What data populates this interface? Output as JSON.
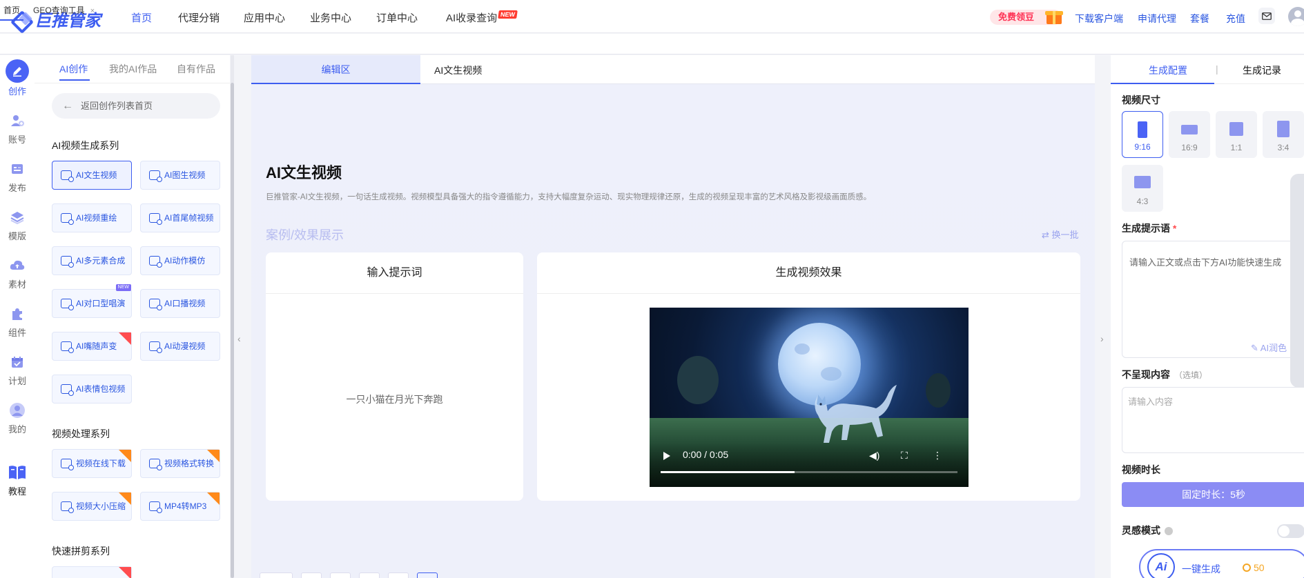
{
  "brand": {
    "name": "巨推管家",
    "accent": "#3d5df0"
  },
  "topnav": {
    "items": [
      {
        "label": "首页",
        "active": true
      },
      {
        "label": "代理分销"
      },
      {
        "label": "应用中心"
      },
      {
        "label": "业务中心"
      },
      {
        "label": "订单中心"
      },
      {
        "label": "AI收录查询",
        "badge": "NEW"
      }
    ],
    "free_label": "免费领豆",
    "right_links": [
      "下载客户端",
      "申请代理",
      "套餐",
      "充值"
    ]
  },
  "tabs": [
    {
      "label": "首页"
    },
    {
      "label": "GEO查询工具",
      "close": "×"
    }
  ],
  "iconbar": [
    {
      "label": "创作",
      "icon": "pen-icon"
    },
    {
      "label": "账号",
      "icon": "user-add-icon"
    },
    {
      "label": "发布",
      "icon": "publish-icon"
    },
    {
      "label": "模版",
      "icon": "layers-icon"
    },
    {
      "label": "素材",
      "icon": "cloud-upload-icon"
    },
    {
      "label": "组件",
      "icon": "puzzle-icon"
    },
    {
      "label": "计划",
      "icon": "calendar-icon"
    },
    {
      "label": "我的",
      "icon": "user-icon"
    },
    {
      "label": "教程",
      "icon": "book-icon"
    }
  ],
  "panel": {
    "tabs": [
      "AI创作",
      "我的AI作品",
      "自有作品"
    ],
    "back_label": "返回创作列表首页",
    "sections": [
      {
        "title": "AI视频生成系列",
        "tools": [
          {
            "label": "AI文生视频",
            "selected": true
          },
          {
            "label": "AI图生视频"
          },
          {
            "label": "AI视频重绘"
          },
          {
            "label": "AI首尾帧视频"
          },
          {
            "label": "AI多元素合成"
          },
          {
            "label": "AI动作模仿"
          },
          {
            "label": "AI对口型唱演",
            "tag": "NEW"
          },
          {
            "label": "AI口播视频"
          },
          {
            "label": "AI嘴随声变",
            "corner": "hot"
          },
          {
            "label": "AI动漫视频"
          },
          {
            "label": "AI表情包视频"
          }
        ]
      },
      {
        "title": "视频处理系列",
        "tools": [
          {
            "label": "视频在线下载",
            "corner": "free"
          },
          {
            "label": "视频格式转换",
            "corner": "free"
          },
          {
            "label": "视频大小压缩",
            "corner": "free"
          },
          {
            "label": "MP4转MP3",
            "corner": "free"
          }
        ]
      },
      {
        "title": "快速拼剪系列",
        "tools": []
      }
    ]
  },
  "center": {
    "tab_edit": "编辑区",
    "tab_title": "AI文生视频",
    "title": "AI文生视频",
    "description": "巨推管家-AI文生视频，一句话生成视频。视频模型具备强大的指令遵循能力，支持大幅度复杂运动、现实物理规律还原，生成的视频呈现丰富的艺术风格及影视级画面质感。",
    "case_title": "案例/效果展示",
    "refresh_label": "换一批",
    "input_card_title": "输入提示词",
    "prompt_example": "一只小猫在月光下奔跑",
    "output_card_title": "生成视频效果",
    "video": {
      "time": "0:00 / 0:05",
      "progress_fraction": 0.45
    }
  },
  "right": {
    "tabs": [
      "生成配置",
      "生成记录"
    ],
    "size_label": "视频尺寸",
    "ratios": [
      {
        "label": "9:16",
        "selected": true
      },
      {
        "label": "16:9"
      },
      {
        "label": "1:1"
      },
      {
        "label": "3:4"
      },
      {
        "label": "4:3"
      }
    ],
    "prompt_label": "生成提示语",
    "prompt_placeholder": "请输入正文或点击下方AI功能快速生成",
    "ai_polish": "AI润色",
    "exclude_label": "不呈现内容",
    "exclude_optional": "（选填）",
    "exclude_placeholder": "请输入内容",
    "duration_label": "视频时长",
    "duration_value": "固定时长：5秒",
    "inspire_label": "灵感模式",
    "generate_label": "一键生成",
    "generate_logo": "Ai",
    "generate_cost": "50"
  }
}
